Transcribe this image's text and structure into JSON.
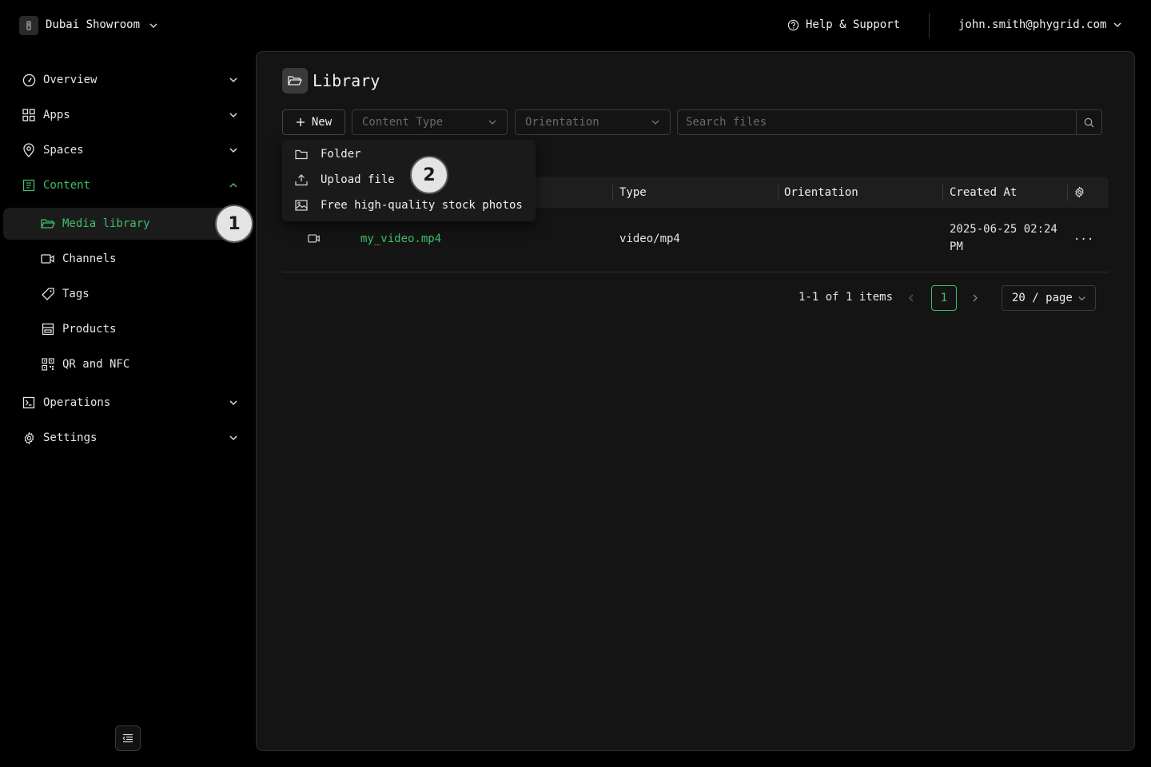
{
  "header": {
    "workspace": "Dubai Showroom",
    "help": "Help & Support",
    "user_email": "john.smith@phygrid.com"
  },
  "sidebar": {
    "items": [
      {
        "label": "Overview",
        "icon": "dashboard-icon"
      },
      {
        "label": "Apps",
        "icon": "apps-grid-icon"
      },
      {
        "label": "Spaces",
        "icon": "location-pin-icon"
      },
      {
        "label": "Content",
        "icon": "content-icon",
        "expanded": true
      },
      {
        "label": "Operations",
        "icon": "terminal-icon"
      },
      {
        "label": "Settings",
        "icon": "gear-icon"
      }
    ],
    "content_sub": [
      {
        "label": "Media library",
        "icon": "folder-open-icon",
        "selected": true
      },
      {
        "label": "Channels",
        "icon": "video-icon"
      },
      {
        "label": "Tags",
        "icon": "tag-icon"
      },
      {
        "label": "Products",
        "icon": "store-icon"
      },
      {
        "label": "QR and NFC",
        "icon": "qr-code-icon"
      }
    ]
  },
  "annotations": {
    "badge_1": "1",
    "badge_2": "2"
  },
  "main": {
    "title": "Library",
    "new_button": "New",
    "content_type_placeholder": "Content Type",
    "orientation_placeholder": "Orientation",
    "search_placeholder": "Search files",
    "new_menu": [
      {
        "label": "Folder",
        "icon": "folder-icon"
      },
      {
        "label": "Upload file",
        "icon": "upload-icon"
      },
      {
        "label": "Free high-quality stock photos",
        "icon": "image-icon"
      }
    ],
    "table": {
      "columns": [
        "Type",
        "Orientation",
        "Created At"
      ],
      "rows": [
        {
          "name": "my_video.mp4",
          "type": "video/mp4",
          "orientation": "",
          "created_line1": "2025-06-25 02:24",
          "created_line2": "PM",
          "actions": "..."
        }
      ]
    },
    "pagination": {
      "info": "1-1 of 1 items",
      "current_page": "1",
      "page_size": "20 / page"
    }
  },
  "colors": {
    "accent": "#3fbf6a",
    "background": "#000000",
    "panel": "#141414"
  }
}
